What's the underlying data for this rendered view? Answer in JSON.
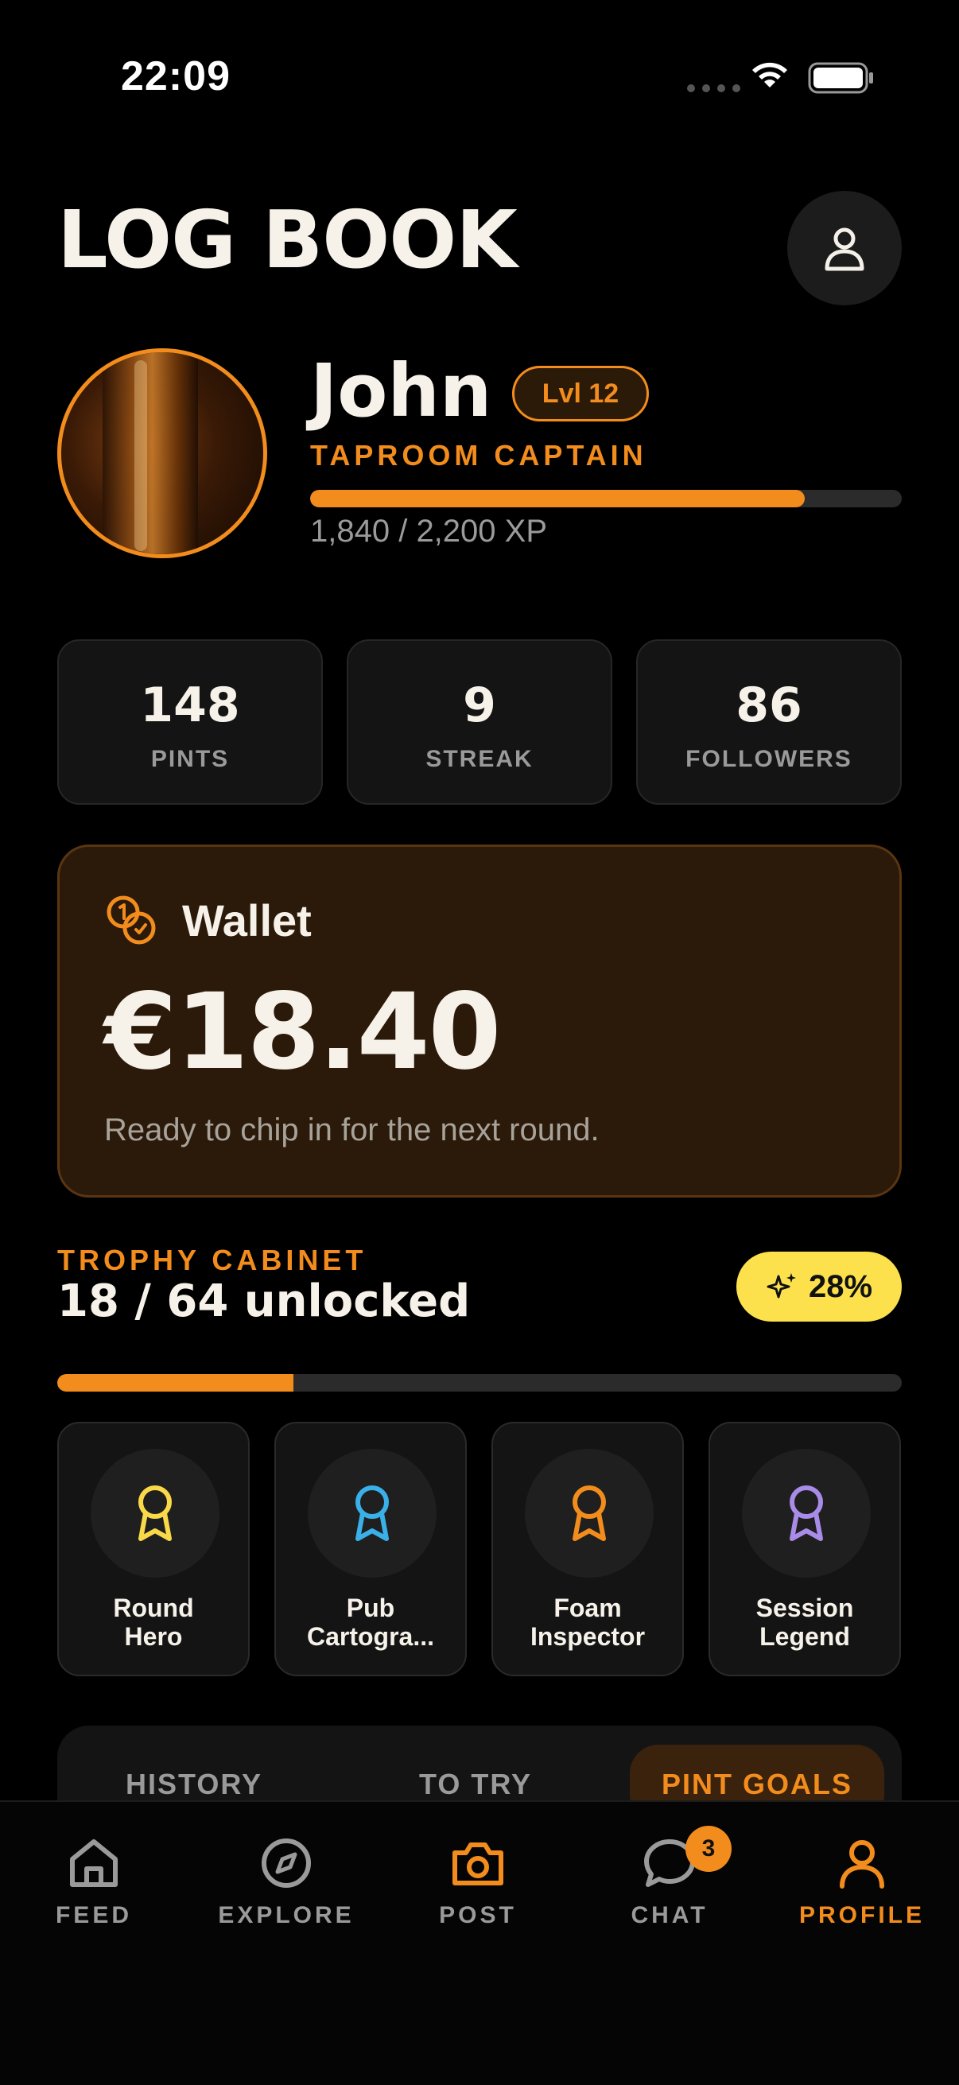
{
  "status_bar": {
    "time": "22:09"
  },
  "header": {
    "title": "LOG BOOK",
    "profile_icon": "person-icon"
  },
  "user": {
    "name": "John",
    "level": "Lvl 12",
    "title": "TAPROOM CAPTAIN",
    "xp_text": "1,840 / 2,200 XP",
    "xp_progress": 0.836
  },
  "stats": [
    {
      "value": "148",
      "label": "PINTS"
    },
    {
      "value": "9",
      "label": "STREAK"
    },
    {
      "value": "86",
      "label": "FOLLOWERS"
    }
  ],
  "wallet": {
    "title": "Wallet",
    "amount": "€18.40",
    "note": "Ready to chip in for the next round.",
    "icon": "coins-icon"
  },
  "trophies": {
    "kicker": "TROPHY CABINET",
    "count": "18 / 64 unlocked",
    "percent": "28%",
    "progress": 0.28,
    "badges": [
      {
        "label": "Round\nHero",
        "color": "#f9d949"
      },
      {
        "label": "Pub\nCartogra...",
        "color": "#3ab0e8"
      },
      {
        "label": "Foam\nInspector",
        "color": "#f28c1c"
      },
      {
        "label": "Session\nLegend",
        "color": "#a98be8"
      }
    ]
  },
  "tabs": [
    {
      "label": "HISTORY",
      "active": false
    },
    {
      "label": "TO TRY",
      "active": false
    },
    {
      "label": "PINT GOALS",
      "active": true
    }
  ],
  "nav": [
    {
      "label": "FEED",
      "icon": "home-icon"
    },
    {
      "label": "EXPLORE",
      "icon": "compass-icon"
    },
    {
      "label": "POST",
      "icon": "camera-icon"
    },
    {
      "label": "CHAT",
      "icon": "chat-icon",
      "badge": "3"
    },
    {
      "label": "PROFILE",
      "icon": "person-icon",
      "active": true
    }
  ],
  "colors": {
    "accent": "#f28c1c",
    "badge_yellow": "#fce14d",
    "background": "#000000"
  }
}
